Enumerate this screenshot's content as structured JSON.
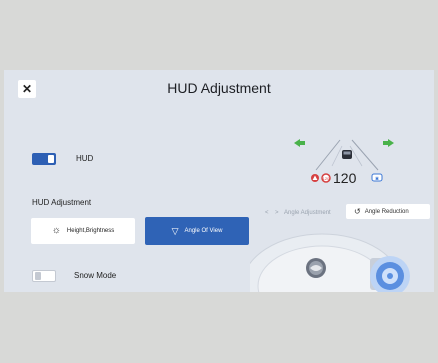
{
  "title": "HUD Adjustment",
  "close_icon": "close-icon",
  "hud_toggle": {
    "label": "HUD",
    "state": "on"
  },
  "section_title": "HUD Adjustment",
  "buttons": {
    "height_brightness": "Height,Brightness",
    "angle_of_view": "Angle Of View"
  },
  "angle_nav": {
    "prev_icon": "chevron-left-icon",
    "next_icon": "chevron-right-icon",
    "current": "Angle Adjustment"
  },
  "angle_reduction_label": "Angle Reduction",
  "snow_mode": {
    "label": "Snow Mode",
    "state": "off"
  },
  "hud_preview": {
    "speed": "120"
  },
  "colors": {
    "accent_blue": "#2f63b6",
    "panel_bg": "#dfe4ec",
    "page_bg": "#d8d9d7",
    "arrow_green": "#49b24a",
    "warning_red": "#d64040"
  }
}
